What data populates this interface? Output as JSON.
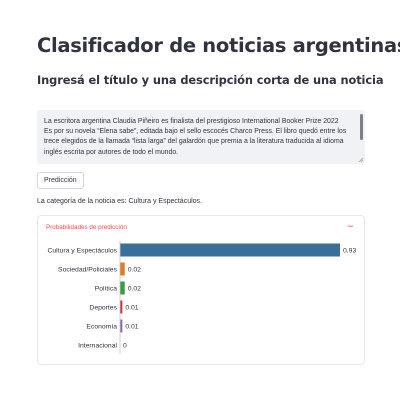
{
  "page": {
    "title": "Clasificador de noticias argentinas",
    "subtitle": "Ingresá el título y una descripción corta de una noticia"
  },
  "input": {
    "lines": [
      "La escritora argentina Claudia Piñeiro es finalista del prestigioso International Booker Prize 2022",
      "Es por su novela “Elena sabe”, editada bajo el sello escocés Charco Press. El libro quedó entre los",
      "trece elegidos de la llamada “lista larga” del galardón que premia a la literatura traducida al idioma",
      "inglés escrita por autores de todo el mundo."
    ]
  },
  "predict_button": {
    "label": "Predicción"
  },
  "result": {
    "text": "La categoría de la noticia es: Cultura y Espectáculos."
  },
  "expander": {
    "label": "Probabilidades de predicción",
    "collapse_icon": "−"
  },
  "chart_data": {
    "type": "bar",
    "orientation": "horizontal",
    "categories": [
      "Cultura y Espectáculos",
      "Sociedad/Policiales",
      "Política",
      "Deportes",
      "Economía",
      "Internacional"
    ],
    "values": [
      0.93,
      0.02,
      0.02,
      0.01,
      0.01,
      0
    ],
    "labels": [
      "0.93",
      "0.02",
      "0.02",
      "0.01",
      "0.01",
      "0"
    ],
    "colors": [
      "#3a6f9a",
      "#e07b28",
      "#3c9a45",
      "#c8383a",
      "#8c6bb1",
      "#8c564b"
    ],
    "xlim": [
      0,
      0.93
    ],
    "grid": false
  },
  "colors": {
    "accent": "#ff4b4b",
    "text": "#31333f",
    "input_bg": "#f0f2f6"
  }
}
